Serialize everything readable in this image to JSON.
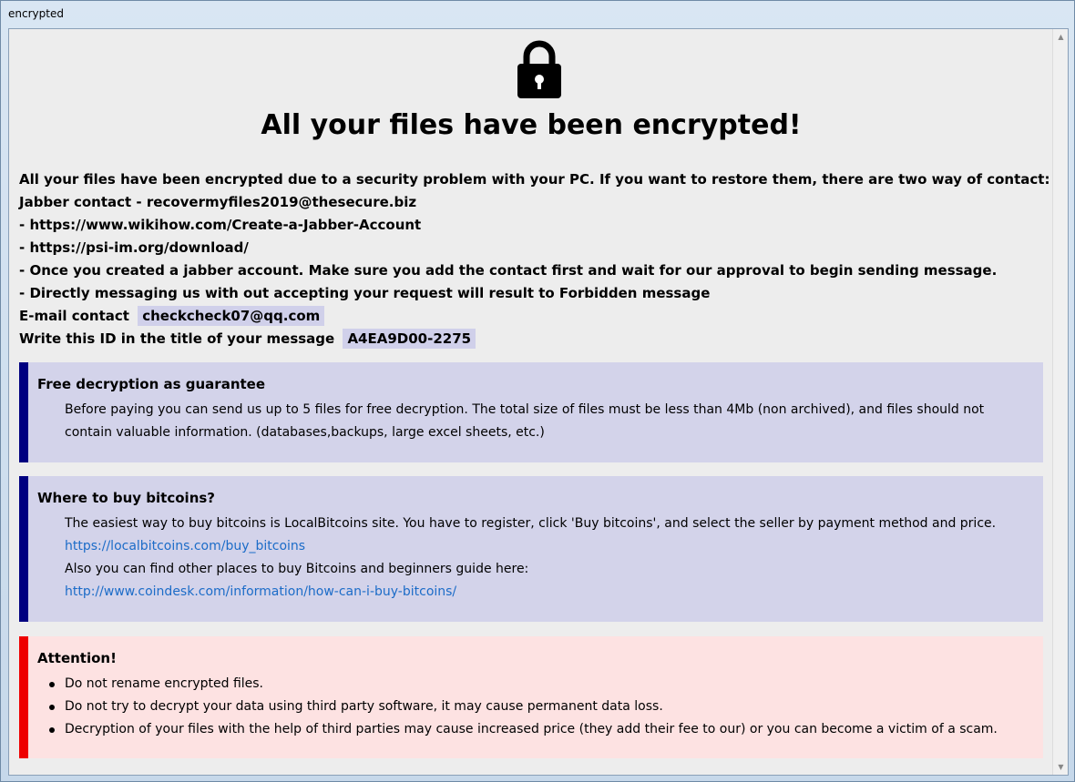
{
  "window": {
    "title": "encrypted"
  },
  "header": {
    "title": "All your files have been encrypted!"
  },
  "intro": {
    "line1": "All your files have been encrypted due to a security problem with your PC. If you want to restore them, there are two way of contact:",
    "line2": "Jabber contact - recovermyfiles2019@thesecure.biz",
    "line3": "- https://www.wikihow.com/Create-a-Jabber-Account",
    "line4": "- https://psi-im.org/download/",
    "line5": "- Once you created a jabber account. Make sure you add the contact first and wait for our approval to begin sending message.",
    "line6": "- Directly messaging us with out accepting your request will result to Forbidden message",
    "email_label": "E-mail contact",
    "email_value": "checkcheck07@qq.com",
    "id_label": "Write this ID in the title of your message",
    "id_value": "A4EA9D00-2275"
  },
  "free_decryption": {
    "title": "Free decryption as guarantee",
    "text": "Before paying you can send us up to 5 files for free decryption. The total size of files must be less than 4Mb (non archived), and files should not contain valuable information. (databases,backups, large excel sheets, etc.)"
  },
  "buy_bitcoins": {
    "title": "Where to buy bitcoins?",
    "text1": "The easiest way to buy bitcoins is LocalBitcoins site. You have to register, click 'Buy bitcoins', and select the seller by payment method and price.",
    "link1": "https://localbitcoins.com/buy_bitcoins",
    "text2": "Also you can find other places to buy Bitcoins and beginners guide here:",
    "link2": "http://www.coindesk.com/information/how-can-i-buy-bitcoins/"
  },
  "attention": {
    "title": "Attention!",
    "items": [
      "Do not rename encrypted files.",
      "Do not try to decrypt your data using third party software, it may cause permanent data loss.",
      "Decryption of your files with the help of third parties may cause increased price (they add their fee to our) or you can become a victim of a scam."
    ]
  },
  "colors": {
    "info_border": "#000080",
    "info_bg": "#d3d3ea",
    "warn_border": "#ee0000",
    "warn_bg": "#fde2e2",
    "link": "#1c6cc8"
  },
  "icons": {
    "lock": "lock-icon",
    "scroll_up": "scroll-up-icon",
    "scroll_down": "scroll-down-icon"
  }
}
